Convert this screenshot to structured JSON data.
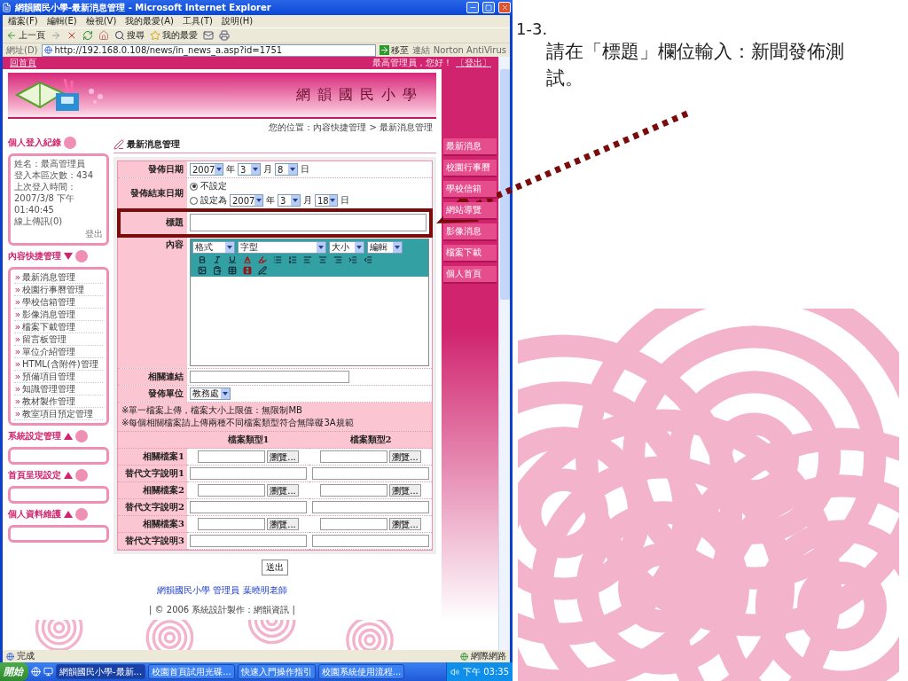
{
  "window": {
    "title": "網韻國民小學-最新消息管理 - Microsoft Internet Explorer",
    "menu": [
      "檔案(F)",
      "編輯(E)",
      "檢視(V)",
      "我的最愛(A)",
      "工具(T)",
      "說明(H)"
    ]
  },
  "toolbar": {
    "back": "上一頁",
    "search": "搜尋",
    "favorites": "我的最愛"
  },
  "address": {
    "label": "網址(D)",
    "url": "http://192.168.0.108/news/in_news_a.asp?id=1751",
    "go": "移至",
    "links": "連結",
    "antivirus": "Norton AntiVirus"
  },
  "page": {
    "home_link": "回首頁",
    "greeting": "最高管理員，您好！",
    "logout": "〔登出〕",
    "site_name": "網韻國民小學",
    "breadcrumb": "您的位置：內容快捷管理 > 最新消息管理"
  },
  "sidebar": {
    "login": {
      "title": "個人登入紀錄",
      "lines": [
        "姓名：最高管理員",
        "登入本區次數：434",
        "上次登入時間：",
        "2007/3/8 下午",
        "01:40:45",
        "線上傳訊(0)"
      ],
      "logout": "登出"
    },
    "sections": [
      {
        "title": "內容快捷管理",
        "expanded": true,
        "items": [
          "最新消息管理",
          "校園行事曆管理",
          "學校信箱管理",
          "影像消息管理",
          "檔案下載管理",
          "留言板管理",
          "單位介紹管理",
          "HTML(含附件)管理",
          "預備項目管理",
          "知識管理管理",
          "教材製作管理",
          "教室項目預定管理"
        ]
      },
      {
        "title": "系統設定管理",
        "expanded": false
      },
      {
        "title": "首頁呈現設定",
        "expanded": false
      },
      {
        "title": "個人資料維護",
        "expanded": false
      }
    ]
  },
  "right_menu": [
    "最新消息",
    "校園行事曆",
    "學校信箱",
    "網站導覽",
    "影像消息",
    "檔案下載",
    "個人首頁"
  ],
  "form": {
    "heading": "最新消息管理",
    "publish_date": {
      "label": "發佈日期",
      "parts": [
        {
          "value": "2007",
          "unit": "年"
        },
        {
          "value": "3",
          "unit": "月"
        },
        {
          "value": "8",
          "unit": "日"
        }
      ]
    },
    "end_date": {
      "label": "發佈結束日期",
      "options": [
        {
          "label": "不設定",
          "selected": true
        },
        {
          "label": "設定為",
          "selected": false
        }
      ],
      "parts": [
        {
          "value": "2007",
          "unit": "年"
        },
        {
          "value": "3",
          "unit": "月"
        },
        {
          "value": "18",
          "unit": "日"
        }
      ]
    },
    "title_field": {
      "label": "標題",
      "highlighted": true
    },
    "content": {
      "label": "內容",
      "selects": [
        "格式",
        "字型",
        "大小",
        "編輯"
      ]
    },
    "link": {
      "label": "相關連結"
    },
    "unit": {
      "label": "發佈單位",
      "value": "教務處"
    },
    "notes": [
      "※單一檔案上傳，檔案大小上限值：無限制MB",
      "※每個相關檔案請上傳兩種不同檔案類型符合無障礙3A規範"
    ],
    "file_columns": [
      "檔案類型1",
      "檔案類型2"
    ],
    "file_rows": [
      {
        "kind": "file",
        "label": "相關檔案1",
        "browse": [
          "瀏覽...",
          "瀏覽..."
        ]
      },
      {
        "kind": "text",
        "label": "替代文字說明1"
      },
      {
        "kind": "file",
        "label": "相關檔案2",
        "browse": [
          "瀏覽...",
          "瀏覽..."
        ]
      },
      {
        "kind": "text",
        "label": "替代文字說明2"
      },
      {
        "kind": "file",
        "label": "相關檔案3",
        "browse": [
          "瀏覽...",
          "瀏覽..."
        ]
      },
      {
        "kind": "text",
        "label": "替代文字說明3"
      }
    ],
    "submit": "送出"
  },
  "footer": {
    "credit": "網韻國民小學 管理員 葉曉明老師",
    "copyright": "| © 2006 系統設計製作：網韻資訊 |"
  },
  "status": {
    "text": "完成",
    "zone": "網際網路"
  },
  "taskbar": {
    "start": "開始",
    "tasks": [
      {
        "label": "網韻國民小學-最新...",
        "selected": true
      },
      {
        "label": "校園首頁試用光碟...",
        "selected": false
      },
      {
        "label": "快速入門操作指引",
        "selected": false
      },
      {
        "label": "校園系統使用流程...",
        "selected": false
      }
    ],
    "clock": "下午 03:35"
  },
  "annotation": {
    "step": "1-3.",
    "text": "請在「標題」欄位輸入：新聞發佈測試。"
  }
}
